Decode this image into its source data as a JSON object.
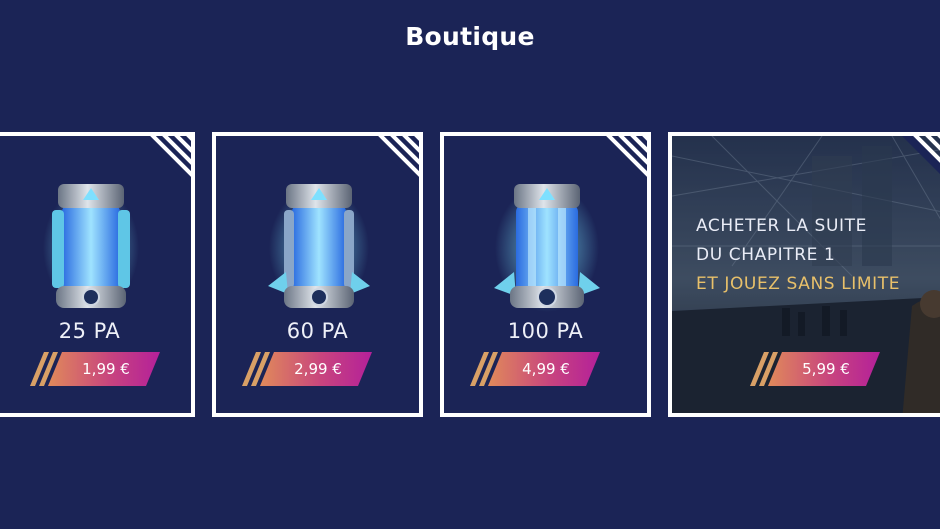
{
  "header": {
    "title": "Boutique"
  },
  "offers": [
    {
      "name": "25 PA",
      "price": "1,99 €",
      "icon": "energy-capsule-small-icon"
    },
    {
      "name": "60 PA",
      "price": "2,99 €",
      "icon": "energy-capsule-medium-icon"
    },
    {
      "name": "100 PA",
      "price": "4,99 €",
      "icon": "energy-capsule-large-icon"
    }
  ],
  "story_offer": {
    "line1": "ACHETER LA SUITE",
    "line2": "DU CHAPITRE 1",
    "line3": "ET JOUEZ SANS LIMITE",
    "price": "5,99 €"
  },
  "colors": {
    "background": "#1b2456",
    "card_border": "#ffffff",
    "price_gradient_start": "#e08a5a",
    "price_gradient_end": "#b4209a",
    "highlight_text": "#e8c06a"
  }
}
